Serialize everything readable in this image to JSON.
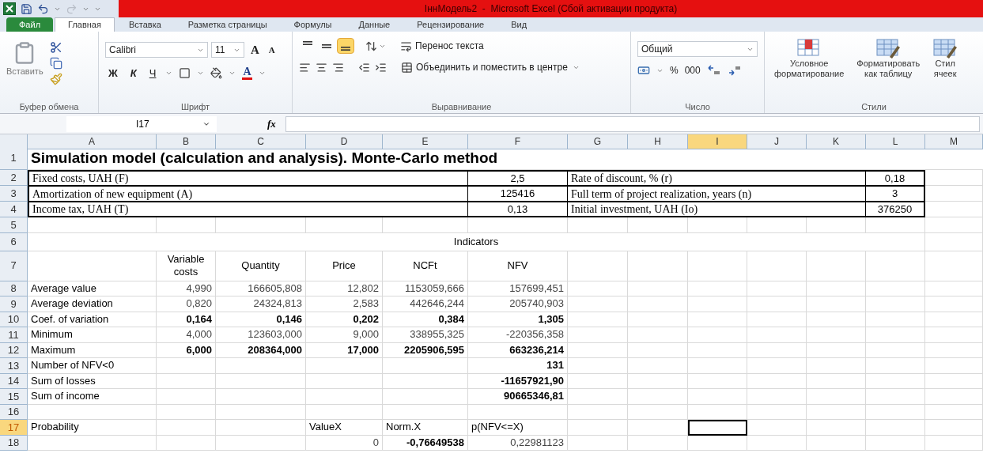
{
  "window": {
    "title": "ІннМодель2  -  Microsoft Excel (Сбой активации продукта)"
  },
  "quick_access": {
    "redo_disabled": true
  },
  "tabs": [
    {
      "label": "Файл",
      "kind": "file",
      "selected": false
    },
    {
      "label": "Главная",
      "kind": "ribbon",
      "selected": true
    },
    {
      "label": "Вставка",
      "kind": "ribbon",
      "selected": false
    },
    {
      "label": "Разметка страницы",
      "kind": "ribbon",
      "selected": false
    },
    {
      "label": "Формулы",
      "kind": "ribbon",
      "selected": false
    },
    {
      "label": "Данные",
      "kind": "ribbon",
      "selected": false
    },
    {
      "label": "Рецензирование",
      "kind": "ribbon",
      "selected": false
    },
    {
      "label": "Вид",
      "kind": "ribbon",
      "selected": false
    }
  ],
  "ribbon": {
    "clipboard": {
      "label": "Буфер обмена",
      "paste": "Вставить"
    },
    "font": {
      "label": "Шрифт",
      "font_name": "Calibri",
      "font_size": "11",
      "grow": "A",
      "shrink": "A",
      "bold": "Ж",
      "italic": "К",
      "underline": "Ч",
      "font_color": "A"
    },
    "alignment": {
      "label": "Выравнивание",
      "vertical": [
        {
          "kind": "top",
          "selected": false
        },
        {
          "kind": "middle",
          "selected": false
        },
        {
          "kind": "bottom",
          "selected": true
        }
      ],
      "wrap": "Перенос текста",
      "merge": "Объединить и поместить в центре"
    },
    "number": {
      "label": "Число",
      "format": "Общий",
      "percent": "%",
      "thousands": "000"
    },
    "styles": {
      "label": "Стили",
      "buttons": [
        {
          "kind": "conditional",
          "lines": [
            "Условное",
            "форматирование"
          ]
        },
        {
          "kind": "table",
          "lines": [
            "Форматировать",
            "как таблицу"
          ]
        },
        {
          "kind": "cell",
          "lines": [
            "Стил",
            "ячеек"
          ]
        }
      ]
    }
  },
  "formula_bar": {
    "name_box": "I17",
    "fx": "fx"
  },
  "sheet": {
    "columns": [
      {
        "label": "A",
        "selected": false
      },
      {
        "label": "B",
        "selected": false
      },
      {
        "label": "C",
        "selected": false
      },
      {
        "label": "D",
        "selected": false
      },
      {
        "label": "E",
        "selected": false
      },
      {
        "label": "F",
        "selected": false
      },
      {
        "label": "G",
        "selected": false
      },
      {
        "label": "H",
        "selected": false
      },
      {
        "label": "I",
        "selected": true
      },
      {
        "label": "J",
        "selected": false
      },
      {
        "label": "K",
        "selected": false
      },
      {
        "label": "L",
        "selected": false
      },
      {
        "label": "M",
        "selected": false
      }
    ],
    "rows": [
      {
        "number": "1",
        "kind": "title",
        "selected": false,
        "text": "Simulation model (calculation and analysis). Monte-Carlo method"
      },
      {
        "number": "2",
        "kind": "params",
        "selected": false,
        "cells": {
          "A": "Fixed costs, UAH (F)",
          "F": "2,5",
          "G": "Rate of discount, % (r)",
          "L": "0,18"
        }
      },
      {
        "number": "3",
        "kind": "params",
        "selected": false,
        "cells": {
          "A": "Amortization of new equipment (A)",
          "F": "125416",
          "G": "Full term of project realization, years (n)",
          "L": "3"
        }
      },
      {
        "number": "4",
        "kind": "params",
        "selected": false,
        "cells": {
          "A": "Income tax, UAH (T)",
          "F": "0,13",
          "G": "Initial investment, UAH  (Io)",
          "L": "376250"
        }
      },
      {
        "number": "5",
        "kind": "table",
        "selected": false,
        "cells": {}
      },
      {
        "number": "6",
        "kind": "band",
        "selected": false,
        "text": "Indicators"
      },
      {
        "number": "7",
        "kind": "header",
        "selected": false,
        "cells": {
          "B": "Variable costs",
          "C": "Quantity",
          "D": "Price",
          "E": "NCFt",
          "F": "NFV"
        }
      },
      {
        "number": "8",
        "kind": "table",
        "selected": false,
        "cells": {
          "A": "Average value",
          "B": "4,990",
          "C": "166605,808",
          "D": "12,802",
          "E": "1153059,666",
          "F": "157699,451"
        }
      },
      {
        "number": "9",
        "kind": "table",
        "selected": false,
        "cells": {
          "A": "Average deviation",
          "B": "0,820",
          "C": "24324,813",
          "D": "2,583",
          "E": "442646,244",
          "F": "205740,903"
        }
      },
      {
        "number": "10",
        "kind": "table",
        "selected": false,
        "cells": {
          "A": "Coef. of variation",
          "B": {
            "text": "0,164",
            "bold": true
          },
          "C": {
            "text": "0,146",
            "bold": true
          },
          "D": {
            "text": "0,202",
            "bold": true
          },
          "E": {
            "text": "0,384",
            "bold": true
          },
          "F": {
            "text": "1,305",
            "bold": true
          }
        }
      },
      {
        "number": "11",
        "kind": "table",
        "selected": false,
        "cells": {
          "A": "Minimum",
          "B": "4,000",
          "C": "123603,000",
          "D": "9,000",
          "E": "338955,325",
          "F": "-220356,358"
        }
      },
      {
        "number": "12",
        "kind": "table",
        "selected": false,
        "cells": {
          "A": "Maximum",
          "B": {
            "text": "6,000",
            "bold": true
          },
          "C": {
            "text": "208364,000",
            "bold": true
          },
          "D": {
            "text": "17,000",
            "bold": true
          },
          "E": {
            "text": "2205906,595",
            "bold": true
          },
          "F": {
            "text": "663236,214",
            "bold": true
          }
        }
      },
      {
        "number": "13",
        "kind": "table",
        "selected": false,
        "cells": {
          "A": "Number of NFV<0",
          "F": {
            "text": "131",
            "bold": true
          }
        }
      },
      {
        "number": "14",
        "kind": "table",
        "selected": false,
        "cells": {
          "A": "Sum of losses",
          "F": {
            "text": "-11657921,90",
            "bold": true
          }
        }
      },
      {
        "number": "15",
        "kind": "table",
        "selected": false,
        "cells": {
          "A": "Sum of income",
          "F": {
            "text": "90665346,81",
            "bold": true
          }
        }
      },
      {
        "number": "16",
        "kind": "table",
        "selected": false,
        "cells": {}
      },
      {
        "number": "17",
        "kind": "table",
        "selected": true,
        "cells": {
          "A": "Probability",
          "D": {
            "text": "ValueX",
            "kind": "label"
          },
          "E": {
            "text": "Norm.X",
            "kind": "label"
          },
          "F": {
            "text": "p(NFV<=X)",
            "kind": "label"
          }
        }
      },
      {
        "number": "18",
        "kind": "table",
        "selected": false,
        "cells": {
          "D": "0",
          "E": {
            "text": "-0,76649538",
            "bold": true
          },
          "F": "0,22981123"
        }
      }
    ]
  }
}
